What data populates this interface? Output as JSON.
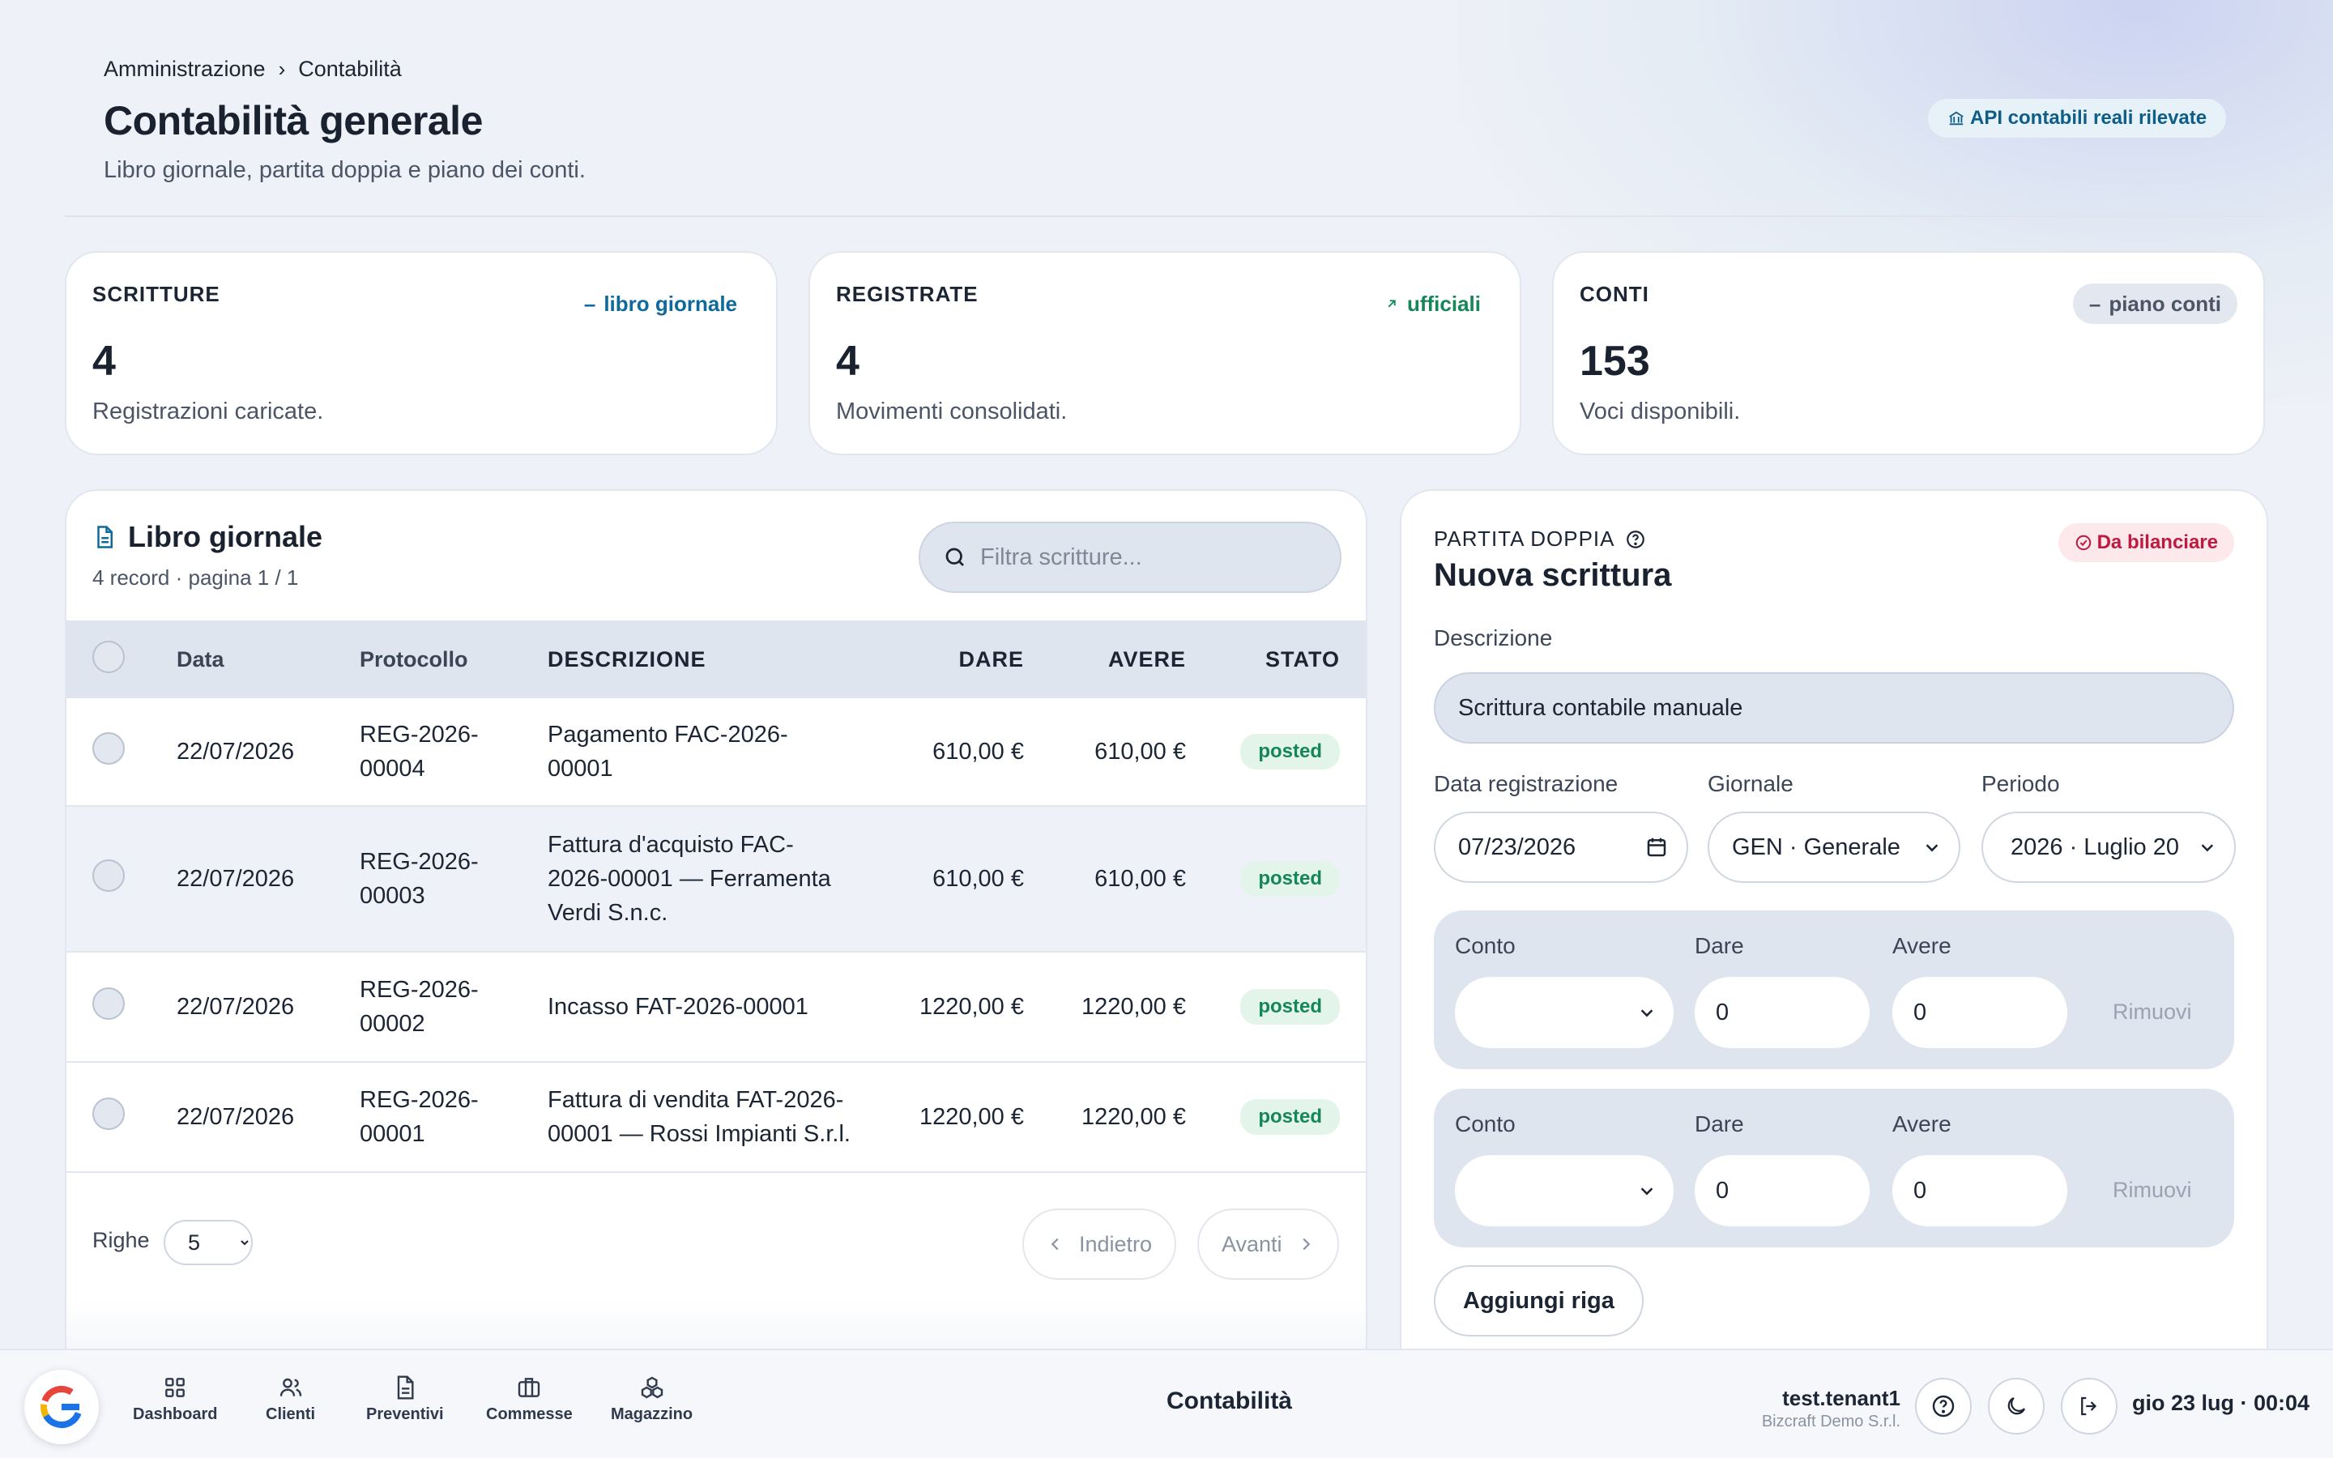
{
  "breadcrumb": [
    "Amministrazione",
    "Contabilità"
  ],
  "header": {
    "title": "Contabilità generale",
    "subtitle": "Libro giornale, partita doppia e piano dei conti.",
    "api_badge": "API contabili reali rilevate"
  },
  "stats": [
    {
      "label": "SCRITTURE",
      "value": "4",
      "desc": "Registrazioni caricate.",
      "tag": "libro giornale"
    },
    {
      "label": "REGISTRATE",
      "value": "4",
      "desc": "Movimenti consolidati.",
      "tag": "ufficiali"
    },
    {
      "label": "CONTI",
      "value": "153",
      "desc": "Voci disponibili.",
      "tag": "piano conti"
    }
  ],
  "journal": {
    "title": "Libro giornale",
    "meta": "4 record · pagina 1 / 1",
    "search_placeholder": "Filtra scritture...",
    "columns": [
      "Data",
      "Protocollo",
      "DESCRIZIONE",
      "DARE",
      "AVERE",
      "STATO"
    ],
    "rows": [
      {
        "date": "22/07/2026",
        "protocol": [
          "REG-2026-",
          "00004"
        ],
        "desc": [
          "Pagamento FAC-2026-",
          "00001"
        ],
        "dare": "610,00 €",
        "avere": "610,00 €",
        "status": "posted"
      },
      {
        "date": "22/07/2026",
        "protocol": [
          "REG-2026-",
          "00003"
        ],
        "desc": [
          "Fattura d'acquisto FAC-",
          "2026-00001 — Ferramenta",
          "Verdi S.n.c."
        ],
        "dare": "610,00 €",
        "avere": "610,00 €",
        "status": "posted"
      },
      {
        "date": "22/07/2026",
        "protocol": [
          "REG-2026-",
          "00002"
        ],
        "desc": [
          "Incasso FAT-2026-00001"
        ],
        "dare": "1220,00 €",
        "avere": "1220,00 €",
        "status": "posted"
      },
      {
        "date": "22/07/2026",
        "protocol": [
          "REG-2026-",
          "00001"
        ],
        "desc": [
          "Fattura di vendita FAT-2026-",
          "00001 — Rossi Impianti S.r.l."
        ],
        "dare": "1220,00 €",
        "avere": "1220,00 €",
        "status": "posted"
      }
    ],
    "rows_label": "Righe",
    "rows_per_page": "5",
    "prev_label": "Indietro",
    "next_label": "Avanti"
  },
  "entry": {
    "kicker": "PARTITA DOPPIA",
    "title": "Nuova scrittura",
    "status": "Da bilanciare",
    "desc_label": "Descrizione",
    "desc_value": "Scrittura contabile manuale",
    "date_label": "Data registrazione",
    "date_value": "07/23/2026",
    "journal_label": "Giornale",
    "journal_value": "GEN · Generale",
    "period_label": "Periodo",
    "period_value": "2026 · Luglio 20",
    "lines": [
      {
        "account_label": "Conto",
        "dare_label": "Dare",
        "dare_value": "0",
        "avere_label": "Avere",
        "avere_value": "0",
        "remove": "Rimuovi"
      },
      {
        "account_label": "Conto",
        "dare_label": "Dare",
        "dare_value": "0",
        "avere_label": "Avere",
        "avere_value": "0",
        "remove": "Rimuovi"
      }
    ],
    "add_row": "Aggiungi riga"
  },
  "bottombar": {
    "nav": [
      "Dashboard",
      "Clienti",
      "Preventivi",
      "Commesse",
      "Magazzino"
    ],
    "title": "Contabilità",
    "user": "test.tenant1",
    "org": "Bizcraft Demo S.r.l.",
    "clock": "gio 23 lug · 00:04"
  },
  "colors": {
    "accent": "#0e6a9a",
    "success": "#15855a",
    "danger": "#c0183e"
  }
}
